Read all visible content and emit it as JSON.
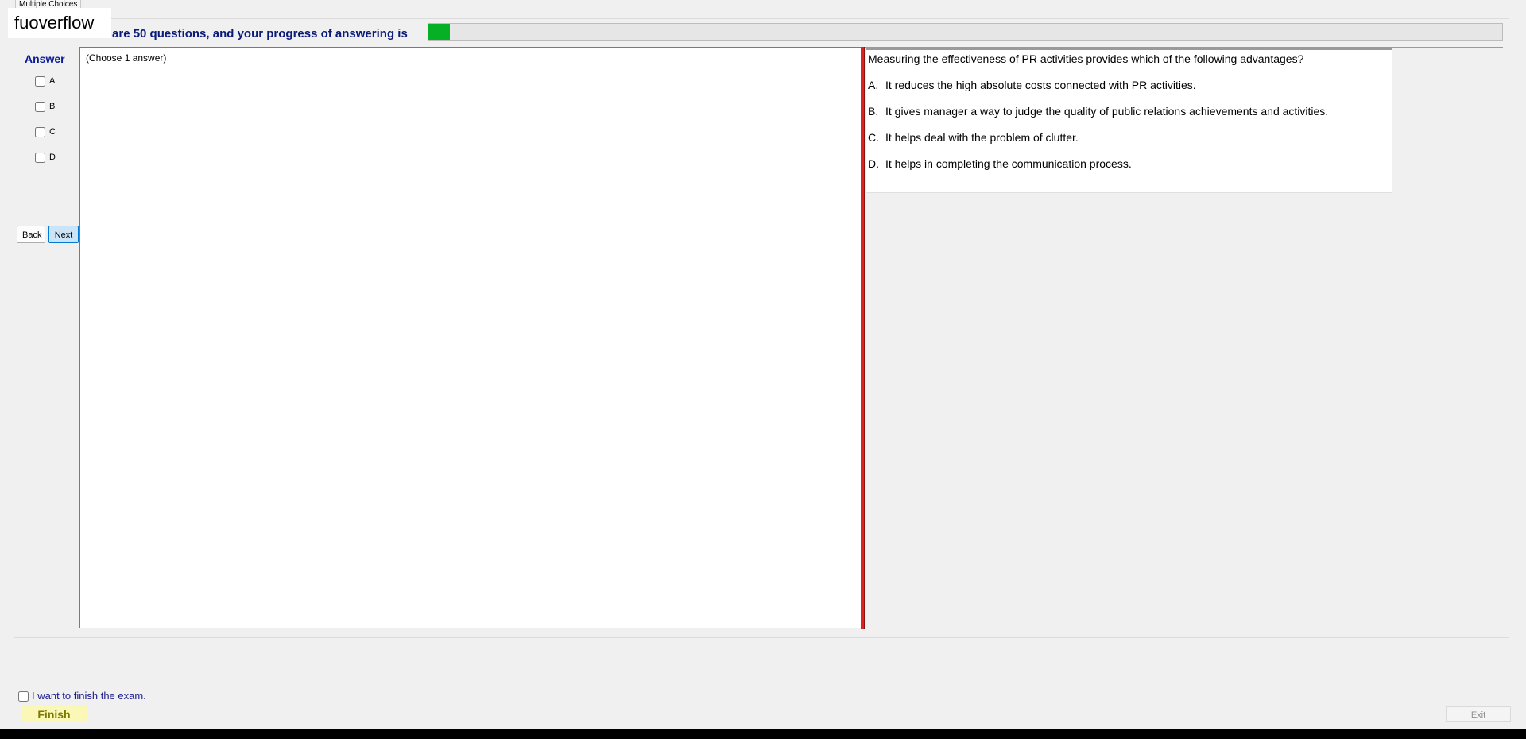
{
  "tab": {
    "label": "Multiple Choices"
  },
  "watermark": "fuoverflow",
  "progress": {
    "text": "There are 50 questions, and your progress of answering is",
    "value_fraction": 0.02
  },
  "answer_panel": {
    "heading": "Answer",
    "options": [
      "A",
      "B",
      "C",
      "D"
    ],
    "back_label": "Back",
    "next_label": "Next"
  },
  "work": {
    "choose_label": "(Choose 1 answer)"
  },
  "question": {
    "text": "Measuring the effectiveness of PR activities provides which of the following advantages?",
    "options": [
      {
        "letter": "A.",
        "text": "It reduces the high absolute costs connected with PR activities."
      },
      {
        "letter": "B.",
        "text": "It gives manager a way to judge the quality of public relations achievements and activities."
      },
      {
        "letter": "C.",
        "text": "It helps deal with the problem of clutter."
      },
      {
        "letter": "D.",
        "text": "It helps in completing the communication process."
      }
    ]
  },
  "footer": {
    "finish_check_label": "I want to finish the exam.",
    "finish_label": "Finish",
    "exit_label": "Exit"
  },
  "colors": {
    "accent_blue": "#0a1a7a",
    "progress_green": "#06b025",
    "splitter_red": "#dd2222",
    "finish_yellow": "#fbf7b6"
  }
}
